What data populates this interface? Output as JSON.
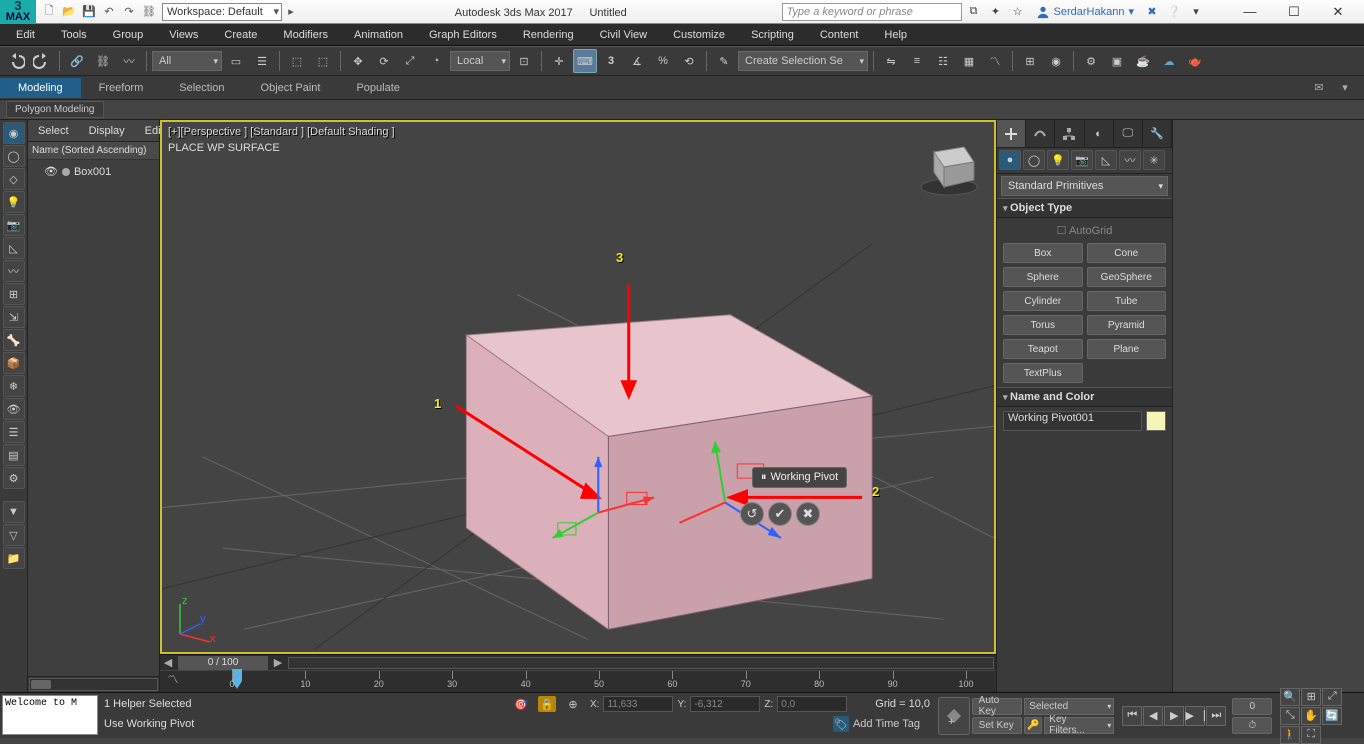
{
  "title": {
    "workspace_label": "Workspace: Default",
    "app": "Autodesk 3ds Max 2017",
    "doc": "Untitled",
    "search_placeholder": "Type a keyword or phrase",
    "user": "SerdarHakann"
  },
  "menubar": [
    "Edit",
    "Tools",
    "Group",
    "Views",
    "Create",
    "Modifiers",
    "Animation",
    "Graph Editors",
    "Rendering",
    "Civil View",
    "Customize",
    "Scripting",
    "Content",
    "Help"
  ],
  "maintb": {
    "sel_filter": "All",
    "refcoord": "Local",
    "named_sel": "Create Selection Se"
  },
  "ribbon": {
    "tabs": [
      "Modeling",
      "Freeform",
      "Selection",
      "Object Paint",
      "Populate"
    ],
    "panel": "Polygon Modeling"
  },
  "scene_explorer": {
    "menus": [
      "Select",
      "Display",
      "Edit"
    ],
    "col_header": "Name (Sorted Ascending)",
    "items": [
      "Box001"
    ]
  },
  "viewport": {
    "label": "[+][Perspective ] [Standard ] [Default Shading ]",
    "mode_text": "PLACE WP SURFACE",
    "tooltip": "Working Pivot",
    "annotations": {
      "a1": "1",
      "a2": "2",
      "a3": "3"
    }
  },
  "timeline": {
    "frame_display": "0 / 100",
    "ticks": [
      0,
      10,
      20,
      30,
      40,
      50,
      60,
      70,
      80,
      90,
      100
    ]
  },
  "command_panel": {
    "category": "Standard Primitives",
    "rollout_objtype": "Object Type",
    "autogrid": "AutoGrid",
    "buttons": [
      [
        "Box",
        "Cone"
      ],
      [
        "Sphere",
        "GeoSphere"
      ],
      [
        "Cylinder",
        "Tube"
      ],
      [
        "Torus",
        "Pyramid"
      ],
      [
        "Teapot",
        "Plane"
      ],
      [
        "TextPlus",
        ""
      ]
    ],
    "rollout_name": "Name and Color",
    "obj_name": "Working Pivot001"
  },
  "status": {
    "script_box": "Welcome to M",
    "line1": "1 Helper Selected",
    "line2": "Use Working Pivot",
    "coords": {
      "x": "11,633",
      "y": "-6,312",
      "z": "0,0"
    },
    "grid": "Grid = 10,0",
    "addtag": "Add Time Tag",
    "autokey": "Auto Key",
    "setkey": "Set Key",
    "selected": "Selected",
    "keyfilters": "Key Filters..."
  }
}
